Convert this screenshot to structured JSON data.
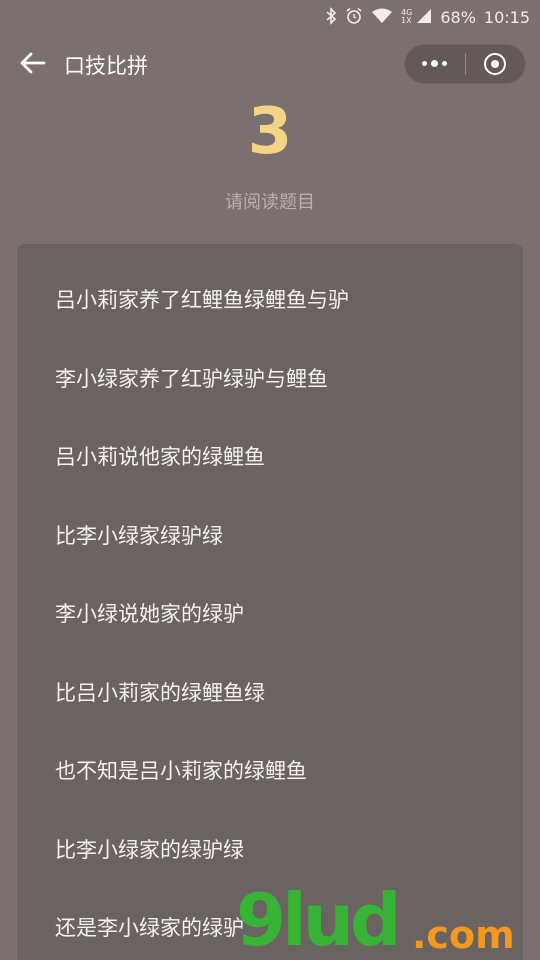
{
  "status_bar": {
    "battery": "68%",
    "time": "10:15",
    "network_top": "4G",
    "network_bottom": "1X"
  },
  "nav": {
    "title": "口技比拼"
  },
  "countdown": "3",
  "instruction": "请阅读题目",
  "lines": [
    "吕小莉家养了红鲤鱼绿鲤鱼与驴",
    "李小绿家养了红驴绿驴与鲤鱼",
    "吕小莉说他家的绿鲤鱼",
    "比李小绿家绿驴绿",
    "李小绿说她家的绿驴",
    "比吕小莉家的绿鲤鱼绿",
    "也不知是吕小莉家的绿鲤鱼",
    "比李小绿家的绿驴绿",
    "还是李小绿家的绿驴"
  ],
  "watermark": {
    "main": "9lud",
    "suffix": ".com"
  },
  "colors": {
    "background": "#7b6f6f",
    "card": "#6b6262",
    "countdown": "#f4d585"
  }
}
